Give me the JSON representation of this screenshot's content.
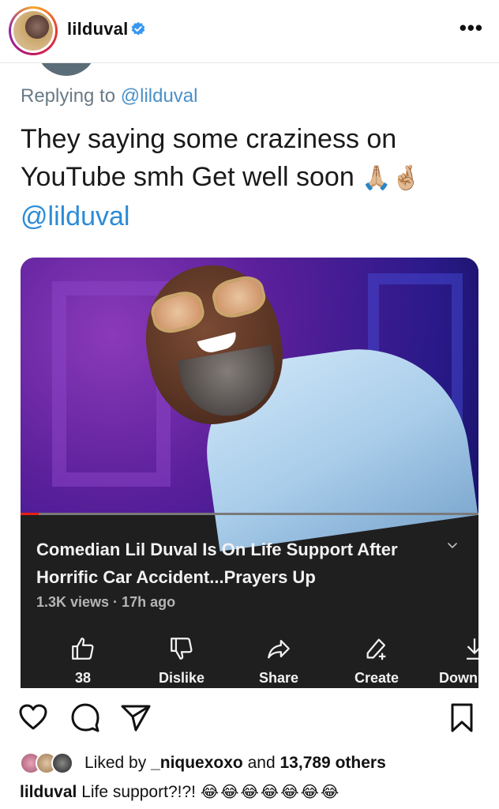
{
  "header": {
    "username": "lilduval",
    "more_label": "•••"
  },
  "tweet": {
    "replying_prefix": "Replying to",
    "replying_handle": "@lilduval",
    "text": "They saying some craziness on YouTube smh Get well soon",
    "emojis": "🙏🏼🤞🏼",
    "mention": "@lilduval"
  },
  "video": {
    "title": "Comedian Lil Duval Is On Life Support After Horrific Car Accident...Prayers Up",
    "meta": "1.3K views · 17h ago",
    "progress_fraction": 0.04,
    "actions": [
      {
        "label": "38",
        "icon": "thumbs-up-icon"
      },
      {
        "label": "Dislike",
        "icon": "thumbs-down-icon"
      },
      {
        "label": "Share",
        "icon": "share-icon"
      },
      {
        "label": "Create",
        "icon": "create-icon"
      },
      {
        "label": "Down",
        "icon": "download-icon"
      }
    ]
  },
  "post": {
    "liked_prefix": "Liked by",
    "liked_user": "_niquexoxo",
    "liked_middle": "and",
    "liked_others": "13,789 others",
    "caption_user": "lilduval",
    "caption_text": "Life support?!?!",
    "caption_emojis": "😂😂😂😂😂😂😂"
  },
  "colors": {
    "verified": "#3897f0",
    "mention": "#2d8bd6",
    "card_bg": "#1f1f1f",
    "progress": "#e62117"
  }
}
